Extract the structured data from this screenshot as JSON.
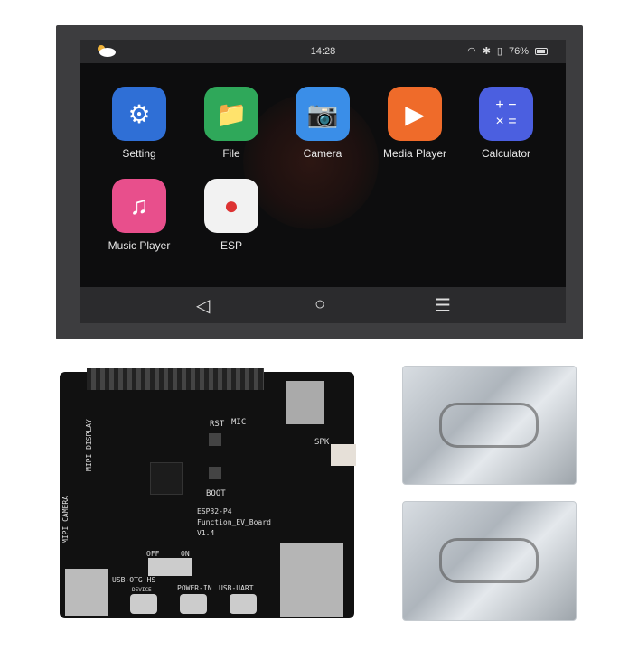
{
  "status_bar": {
    "time": "14:28",
    "battery": "76%",
    "icons": [
      "weather-cloud-icon",
      "wifi-icon",
      "bluetooth-icon",
      "usb-icon",
      "battery-icon"
    ]
  },
  "apps": [
    {
      "label": "Setting",
      "icon": "gear-icon",
      "color": "#2f6fd6"
    },
    {
      "label": "File",
      "icon": "folder-icon",
      "color": "#2fa85a"
    },
    {
      "label": "Camera",
      "icon": "camera-icon",
      "color": "#3a8ee8"
    },
    {
      "label": "Media Player",
      "icon": "play-icon",
      "color": "#ef6b2a"
    },
    {
      "label": "Calculator",
      "icon": "calculator-icon",
      "color": "#4b5fe0"
    },
    {
      "label": "Music Player",
      "icon": "music-note-icon",
      "color": "#e84f8c"
    },
    {
      "label": "ESP",
      "icon": "esp-logo-icon",
      "color": "#f2f2f2"
    }
  ],
  "nav_bar": {
    "icons": [
      "back-icon",
      "home-icon",
      "menu-icon"
    ]
  },
  "board": {
    "name": "ESP32-P4",
    "subtitle": "Function_EV_Board",
    "version": "V1.4",
    "labels": {
      "rst": "RST",
      "mic": "MIC",
      "boot": "BOOT",
      "spk": "SPK",
      "display": "MIPI DISPLAY",
      "camera": "MIPI CAMERA",
      "off": "OFF",
      "on": "ON",
      "usb_otg": "USB-OTG HS",
      "device": "DEVICE",
      "power_in": "POWER-IN",
      "usb_uart": "USB-UART"
    }
  }
}
